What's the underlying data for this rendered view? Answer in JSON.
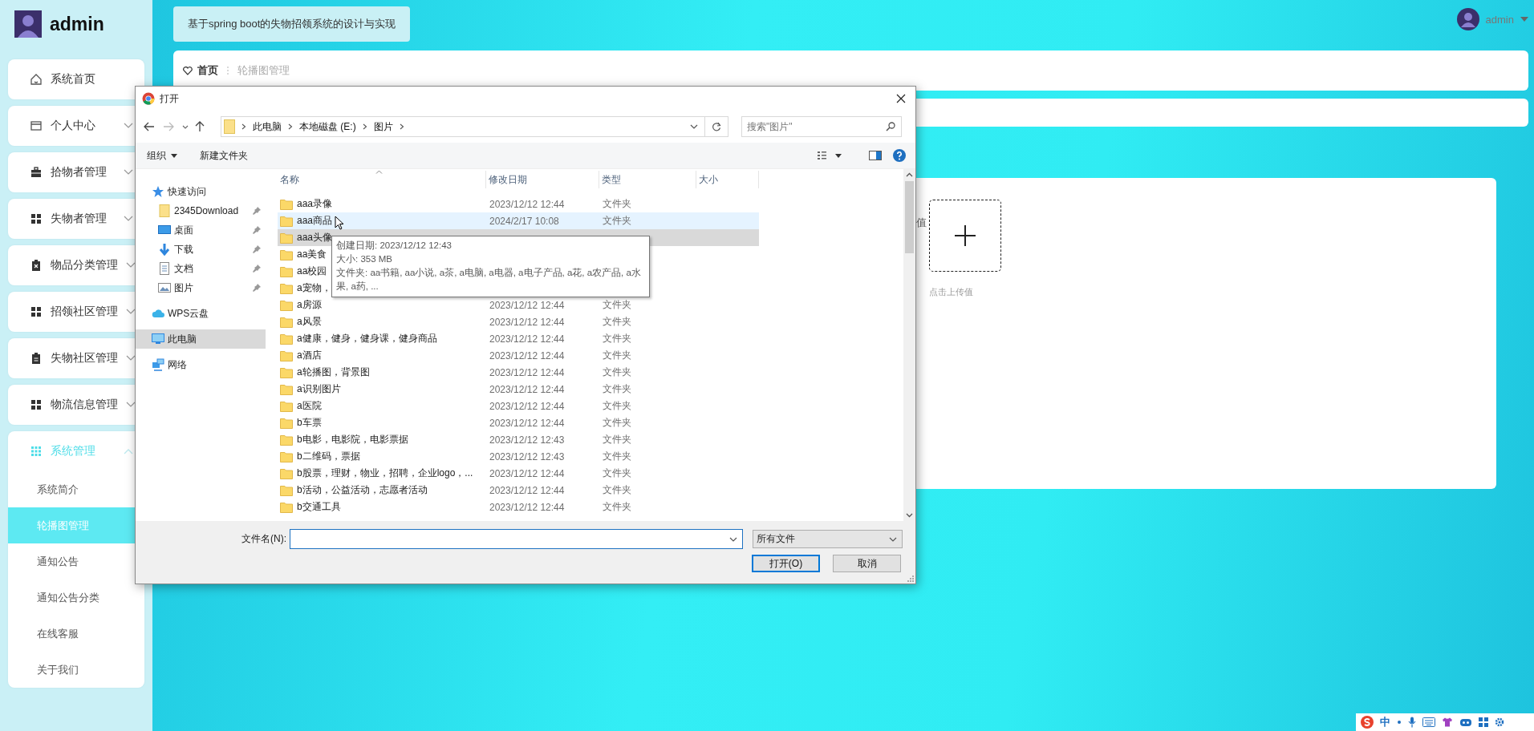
{
  "sidebar": {
    "user": "admin",
    "menu": [
      {
        "label": "系统首页",
        "kind": "link"
      },
      {
        "label": "个人中心",
        "kind": "group",
        "expanded": false
      },
      {
        "label": "拾物者管理",
        "kind": "group",
        "expanded": false
      },
      {
        "label": "失物者管理",
        "kind": "group",
        "expanded": false
      },
      {
        "label": "物品分类管理",
        "kind": "group",
        "expanded": false
      },
      {
        "label": "招领社区管理",
        "kind": "group",
        "expanded": false
      },
      {
        "label": "失物社区管理",
        "kind": "group",
        "expanded": false
      },
      {
        "label": "物流信息管理",
        "kind": "group",
        "expanded": false
      },
      {
        "label": "系统管理",
        "kind": "group",
        "expanded": true,
        "children": [
          {
            "label": "系统简介",
            "selected": false
          },
          {
            "label": "轮播图管理",
            "selected": true
          },
          {
            "label": "通知公告",
            "selected": false
          },
          {
            "label": "通知公告分类",
            "selected": false
          },
          {
            "label": "在线客服",
            "selected": false
          },
          {
            "label": "关于我们",
            "selected": false
          }
        ]
      }
    ]
  },
  "header": {
    "title": "基于spring boot的失物招领系统的设计与实现",
    "user": "admin"
  },
  "breadcrumb": [
    "首页",
    "轮播图管理"
  ],
  "upload": {
    "label": "值",
    "hint": "点击上传值"
  },
  "dialog": {
    "title": "打开",
    "path": [
      "此电脑",
      "本地磁盘 (E:)",
      "图片"
    ],
    "search_placeholder": "搜索\"图片\"",
    "toolbar": [
      {
        "label": "组织",
        "kind": "menu"
      },
      {
        "label": "新建文件夹",
        "kind": "button"
      }
    ],
    "nav": [
      {
        "label": "快速访问",
        "selected": false,
        "pinned": false,
        "children": [
          {
            "label": "2345Download",
            "selected": false,
            "pinned": true
          },
          {
            "label": "桌面",
            "selected": false,
            "pinned": true
          },
          {
            "label": "下载",
            "selected": false,
            "pinned": true
          },
          {
            "label": "文档",
            "selected": false,
            "pinned": true
          },
          {
            "label": "图片",
            "selected": false,
            "pinned": true
          }
        ]
      },
      {
        "label": "WPS云盘",
        "selected": false,
        "pinned": false
      },
      {
        "label": "此电脑",
        "selected": true,
        "pinned": false
      },
      {
        "label": "网络",
        "selected": false,
        "pinned": false
      }
    ],
    "columns": [
      "名称",
      "修改日期",
      "类型",
      "大小"
    ],
    "rows": [
      {
        "name": "aaa录像",
        "date": "2023/12/12 12:44",
        "type": "文件夹",
        "selected": false,
        "hovered": false
      },
      {
        "name": "aaa商品",
        "date": "2024/2/17 10:08",
        "type": "文件夹",
        "selected": false,
        "hovered": true
      },
      {
        "name": "aaa头像",
        "selected": true,
        "hovered": false
      },
      {
        "name": "aa美食",
        "selected": false,
        "hovered": false
      },
      {
        "name": "aa校园",
        "selected": false,
        "hovered": false
      },
      {
        "name": "a宠物，",
        "selected": false,
        "hovered": false
      },
      {
        "name": "a房源",
        "date": "2023/12/12 12:44",
        "type": "文件夹",
        "selected": false,
        "hovered": false
      },
      {
        "name": "a风景",
        "date": "2023/12/12 12:44",
        "type": "文件夹",
        "selected": false,
        "hovered": false
      },
      {
        "name": "a健康，健身，健身课，健身商品",
        "date": "2023/12/12 12:44",
        "type": "文件夹",
        "selected": false,
        "hovered": false
      },
      {
        "name": "a酒店",
        "date": "2023/12/12 12:44",
        "type": "文件夹",
        "selected": false,
        "hovered": false
      },
      {
        "name": "a轮播图，背景图",
        "date": "2023/12/12 12:44",
        "type": "文件夹",
        "selected": false,
        "hovered": false
      },
      {
        "name": "a识别图片",
        "date": "2023/12/12 12:44",
        "type": "文件夹",
        "selected": false,
        "hovered": false
      },
      {
        "name": "a医院",
        "date": "2023/12/12 12:44",
        "type": "文件夹",
        "selected": false,
        "hovered": false
      },
      {
        "name": "b车票",
        "date": "2023/12/12 12:44",
        "type": "文件夹",
        "selected": false,
        "hovered": false
      },
      {
        "name": "b电影，电影院，电影票据",
        "date": "2023/12/12 12:43",
        "type": "文件夹",
        "selected": false,
        "hovered": false
      },
      {
        "name": "b二维码，票据",
        "date": "2023/12/12 12:43",
        "type": "文件夹",
        "selected": false,
        "hovered": false
      },
      {
        "name": "b股票，理财，物业，招聘，企业logo，...",
        "date": "2023/12/12 12:44",
        "type": "文件夹",
        "selected": false,
        "hovered": false
      },
      {
        "name": "b活动，公益活动，志愿者活动",
        "date": "2023/12/12 12:44",
        "type": "文件夹",
        "selected": false,
        "hovered": false
      },
      {
        "name": "b交通工具",
        "date": "2023/12/12 12:44",
        "type": "文件夹",
        "selected": false,
        "hovered": false
      }
    ],
    "tooltip": [
      "创建日期: 2023/12/12 12:43",
      "大小: 353 MB",
      "文件夹: aa书籍, aa小说, a茶, a电脑, a电器, a电子产品, a花, a农产品, a水果, a药, ..."
    ],
    "filename_label": "文件名(N):",
    "filter": "所有文件",
    "buttons": [
      {
        "label": "打开(O)",
        "default": true
      },
      {
        "label": "取消",
        "default": false
      }
    ]
  },
  "ime_bar": {
    "label": "中"
  }
}
